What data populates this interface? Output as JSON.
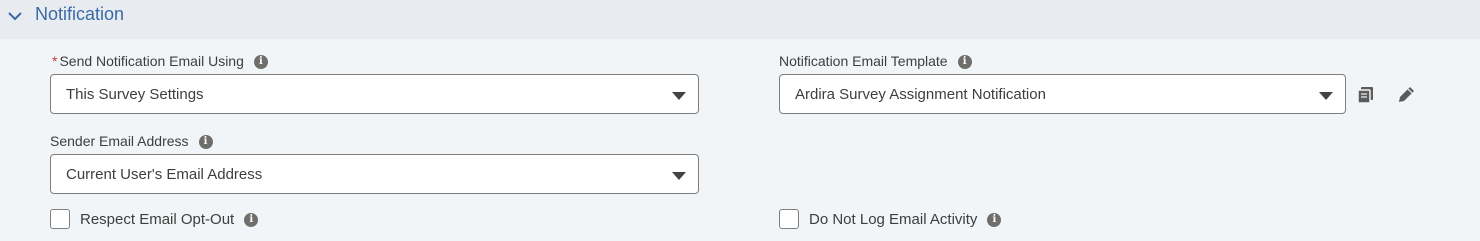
{
  "section": {
    "title": "Notification",
    "expanded": true
  },
  "fields": {
    "send_using": {
      "required_marker": "*",
      "label": "Send Notification Email Using",
      "value": "This Survey Settings"
    },
    "template": {
      "label": "Notification Email Template",
      "value": "Ardira Survey Assignment Notification"
    },
    "sender": {
      "label": "Sender Email Address",
      "value": "Current User's Email Address"
    },
    "opt_out": {
      "label": "Respect Email Opt-Out",
      "checked": false
    },
    "log_activity": {
      "label": "Do Not Log Email Activity",
      "checked": false
    }
  },
  "icons": {
    "info": "i",
    "chevron": "chevron-down-icon",
    "copy": "copy-icon",
    "edit": "pencil-icon"
  },
  "colors": {
    "accent": "#3a6aa6",
    "required": "#c23934",
    "header_bg": "#e8ecf1",
    "panel_bg": "#f1f5f8"
  }
}
